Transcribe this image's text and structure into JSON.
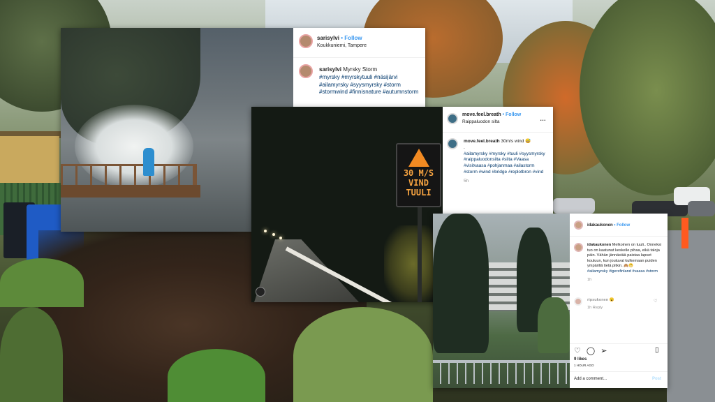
{
  "posts": [
    {
      "username": "sarisylvi",
      "follow_label": "• Follow",
      "location": "Koukkuniemi, Tampere",
      "caption_title": "Myrsky Storm",
      "hashtags": "#myrsky #myrskytuuli #näsijärvi #ailamyrsky #syysmyrsky #storm #stormwind #finnisnature #autumnstorm"
    },
    {
      "username": "move.feel.breath",
      "follow_label": "• Follow",
      "location": "Raippaluodon silta",
      "caption_title": "30m/s wind 😅",
      "hashtags": "#ailamyrsky #myrsky #tuuli #syysmyrsky #raippaluodonsilta #silta #Vaasa #visitvaasa #pohjanmaa #ailastorm #storm #wind #bridge #replotbron #vind",
      "age": "5h",
      "sign_text": [
        "30 M/S",
        "VIND",
        "TUULI"
      ]
    },
    {
      "username": "idakaukonen",
      "follow_label": "• Follow",
      "caption_title": "Melkoinen on tuuli.. Onneksi tuo on kaatunut keskelle pihaa, eikä taloja päin. Vähän jännästää paistaa lapset kouluun, kun joutuvat kulkemaan puiden ympärillä tietä pitkin. 🙈😬",
      "hashtags": "#ailamyrsky #igersfinland #vaasa #storm",
      "age": "1h",
      "comment_user": "ripsukonen",
      "comment_emoji": "😮",
      "comment_age": "1h",
      "reply_label": "Reply",
      "likes": "9 likes",
      "time_ago": "1 HOUR AGO",
      "add_comment": "Add a comment...",
      "post_label": "Post"
    }
  ]
}
